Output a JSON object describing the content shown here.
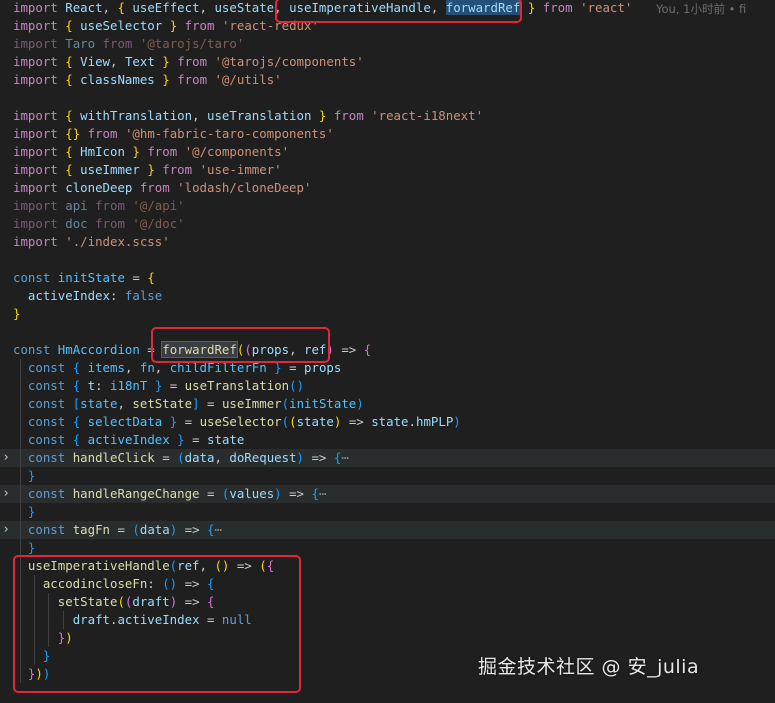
{
  "blame_text": "You, 1小时前 • fi",
  "watermark": "掘金技术社区 @ 安_julia",
  "colors": {
    "background": "#1f1f1f",
    "annotation_box": "#e0283a",
    "keyword": "#5c9fd6",
    "import_keyword": "#c586c0",
    "string": "#ce9178",
    "variable": "#9cdcfe",
    "constant": "#4fc1ff",
    "function": "#dcdcaa"
  },
  "lines": [
    {
      "tokens": [
        [
          "import",
          "imp"
        ],
        [
          " "
        ],
        [
          "React",
          "var"
        ],
        [
          ", "
        ],
        [
          "{",
          "br1"
        ],
        [
          " "
        ],
        [
          "useEffect",
          "var"
        ],
        [
          ", "
        ],
        [
          "useState",
          "var"
        ],
        [
          ", "
        ],
        [
          "useImperativeHandle",
          "var"
        ],
        [
          ", "
        ],
        [
          "forwardRef",
          "var selblue"
        ],
        [
          " "
        ],
        [
          "}",
          "br1"
        ],
        [
          " "
        ],
        [
          "from",
          "imp"
        ],
        [
          " "
        ],
        [
          "'react'",
          "str"
        ]
      ]
    },
    {
      "tokens": [
        [
          "import",
          "imp"
        ],
        [
          " "
        ],
        [
          "{",
          "br1"
        ],
        [
          " "
        ],
        [
          "useSelector",
          "var"
        ],
        [
          " "
        ],
        [
          "}",
          "br1"
        ],
        [
          " "
        ],
        [
          "from",
          "imp"
        ],
        [
          " "
        ],
        [
          "'react-redux'",
          "str"
        ]
      ]
    },
    {
      "tokens": [
        [
          "import",
          "imp dim"
        ],
        [
          " "
        ],
        [
          "Taro",
          "var dim"
        ],
        [
          " "
        ],
        [
          "from",
          "imp dim"
        ],
        [
          " "
        ],
        [
          "'@tarojs/taro'",
          "str dim"
        ]
      ]
    },
    {
      "tokens": [
        [
          "import",
          "imp"
        ],
        [
          " "
        ],
        [
          "{",
          "br1"
        ],
        [
          " "
        ],
        [
          "View",
          "var"
        ],
        [
          ", "
        ],
        [
          "Text",
          "var"
        ],
        [
          " "
        ],
        [
          "}",
          "br1"
        ],
        [
          " "
        ],
        [
          "from",
          "imp"
        ],
        [
          " "
        ],
        [
          "'@tarojs/components'",
          "str"
        ]
      ]
    },
    {
      "tokens": [
        [
          "import",
          "imp"
        ],
        [
          " "
        ],
        [
          "{",
          "br1"
        ],
        [
          " "
        ],
        [
          "classNames",
          "var"
        ],
        [
          " "
        ],
        [
          "}",
          "br1"
        ],
        [
          " "
        ],
        [
          "from",
          "imp"
        ],
        [
          " "
        ],
        [
          "'@/utils'",
          "str"
        ]
      ]
    },
    {
      "tokens": []
    },
    {
      "tokens": [
        [
          "import",
          "imp"
        ],
        [
          " "
        ],
        [
          "{",
          "br1"
        ],
        [
          " "
        ],
        [
          "withTranslation",
          "var"
        ],
        [
          ", "
        ],
        [
          "useTranslation",
          "var"
        ],
        [
          " "
        ],
        [
          "}",
          "br1"
        ],
        [
          " "
        ],
        [
          "from",
          "imp"
        ],
        [
          " "
        ],
        [
          "'react-i18next'",
          "str"
        ]
      ]
    },
    {
      "tokens": [
        [
          "import",
          "imp"
        ],
        [
          " "
        ],
        [
          "{}",
          "br1"
        ],
        [
          " "
        ],
        [
          "from",
          "imp"
        ],
        [
          " "
        ],
        [
          "'@hm-fabric-taro-components'",
          "str"
        ]
      ]
    },
    {
      "tokens": [
        [
          "import",
          "imp"
        ],
        [
          " "
        ],
        [
          "{",
          "br1"
        ],
        [
          " "
        ],
        [
          "HmIcon",
          "var"
        ],
        [
          " "
        ],
        [
          "}",
          "br1"
        ],
        [
          " "
        ],
        [
          "from",
          "imp"
        ],
        [
          " "
        ],
        [
          "'@/components'",
          "str"
        ]
      ]
    },
    {
      "tokens": [
        [
          "import",
          "imp"
        ],
        [
          " "
        ],
        [
          "{",
          "br1"
        ],
        [
          " "
        ],
        [
          "useImmer",
          "var"
        ],
        [
          " "
        ],
        [
          "}",
          "br1"
        ],
        [
          " "
        ],
        [
          "from",
          "imp"
        ],
        [
          " "
        ],
        [
          "'use-immer'",
          "str"
        ]
      ]
    },
    {
      "tokens": [
        [
          "import",
          "imp"
        ],
        [
          " "
        ],
        [
          "cloneDeep",
          "var"
        ],
        [
          " "
        ],
        [
          "from",
          "imp"
        ],
        [
          " "
        ],
        [
          "'lodash/cloneDeep'",
          "str"
        ]
      ]
    },
    {
      "tokens": [
        [
          "import",
          "imp dim"
        ],
        [
          " "
        ],
        [
          "api",
          "var dim"
        ],
        [
          " "
        ],
        [
          "from",
          "imp dim"
        ],
        [
          " "
        ],
        [
          "'@/api'",
          "str dim"
        ]
      ]
    },
    {
      "tokens": [
        [
          "import",
          "imp dim"
        ],
        [
          " "
        ],
        [
          "doc",
          "var dim"
        ],
        [
          " "
        ],
        [
          "from",
          "imp dim"
        ],
        [
          " "
        ],
        [
          "'@/doc'",
          "str dim"
        ]
      ]
    },
    {
      "tokens": [
        [
          "import",
          "imp"
        ],
        [
          " "
        ],
        [
          "'./index.scss'",
          "str"
        ]
      ]
    },
    {
      "tokens": []
    },
    {
      "tokens": [
        [
          "const",
          "kw"
        ],
        [
          " "
        ],
        [
          "initState",
          "cst"
        ],
        [
          " = "
        ],
        [
          "{",
          "br1"
        ]
      ]
    },
    {
      "tokens": [
        [
          "  "
        ],
        [
          "activeIndex",
          "var"
        ],
        [
          ": "
        ],
        [
          "false",
          "kw"
        ]
      ]
    },
    {
      "tokens": [
        [
          "}",
          "br1"
        ]
      ]
    },
    {
      "tokens": []
    },
    {
      "tokens": [
        [
          "const",
          "kw"
        ],
        [
          " "
        ],
        [
          "HmAccordion",
          "cst"
        ],
        [
          " = "
        ],
        [
          "forwardRef",
          "fn sel"
        ],
        [
          "(",
          "br1"
        ],
        [
          "(",
          "br2"
        ],
        [
          "props",
          "var"
        ],
        [
          ", "
        ],
        [
          "ref",
          "var"
        ],
        [
          ")",
          "br2"
        ],
        [
          " => "
        ],
        [
          "{",
          "br2"
        ]
      ]
    },
    {
      "tokens": [
        [
          "  "
        ],
        [
          "const",
          "kw"
        ],
        [
          " "
        ],
        [
          "{",
          "br3"
        ],
        [
          " "
        ],
        [
          "items",
          "cst"
        ],
        [
          ", "
        ],
        [
          "fn",
          "cst"
        ],
        [
          ", "
        ],
        [
          "childFilterFn",
          "cst"
        ],
        [
          " "
        ],
        [
          "}",
          "br3"
        ],
        [
          " = "
        ],
        [
          "props",
          "var"
        ]
      ]
    },
    {
      "tokens": [
        [
          "  "
        ],
        [
          "const",
          "kw"
        ],
        [
          " "
        ],
        [
          "{",
          "br3"
        ],
        [
          " "
        ],
        [
          "t",
          "var"
        ],
        [
          ": "
        ],
        [
          "i18nT",
          "cst"
        ],
        [
          " "
        ],
        [
          "}",
          "br3"
        ],
        [
          " = "
        ],
        [
          "useTranslation",
          "fn"
        ],
        [
          "()",
          "br3"
        ]
      ]
    },
    {
      "tokens": [
        [
          "  "
        ],
        [
          "const",
          "kw"
        ],
        [
          " "
        ],
        [
          "[",
          "br3"
        ],
        [
          "state",
          "cst"
        ],
        [
          ", "
        ],
        [
          "setState",
          "fn"
        ],
        [
          "]",
          "br3"
        ],
        [
          " = "
        ],
        [
          "useImmer",
          "fn"
        ],
        [
          "(",
          "br3"
        ],
        [
          "initState",
          "cst"
        ],
        [
          ")",
          "br3"
        ]
      ]
    },
    {
      "tokens": [
        [
          "  "
        ],
        [
          "const",
          "kw"
        ],
        [
          " "
        ],
        [
          "{",
          "br3"
        ],
        [
          " "
        ],
        [
          "selectData",
          "cst"
        ],
        [
          " "
        ],
        [
          "}",
          "br3"
        ],
        [
          " = "
        ],
        [
          "useSelector",
          "fn"
        ],
        [
          "(",
          "br3"
        ],
        [
          "(",
          "br1"
        ],
        [
          "state",
          "var"
        ],
        [
          ")",
          "br1"
        ],
        [
          " => "
        ],
        [
          "state",
          "var"
        ],
        [
          "."
        ],
        [
          "hmPLP",
          "var"
        ],
        [
          ")",
          "br3"
        ]
      ]
    },
    {
      "tokens": [
        [
          "  "
        ],
        [
          "const",
          "kw"
        ],
        [
          " "
        ],
        [
          "{",
          "br3"
        ],
        [
          " "
        ],
        [
          "activeIndex",
          "cst"
        ],
        [
          " "
        ],
        [
          "}",
          "br3"
        ],
        [
          " = "
        ],
        [
          "state",
          "var"
        ]
      ]
    },
    {
      "fold": true,
      "hl": true,
      "tokens": [
        [
          "  "
        ],
        [
          "const",
          "kw"
        ],
        [
          " "
        ],
        [
          "handleClick",
          "fn"
        ],
        [
          " = "
        ],
        [
          "(",
          "br3"
        ],
        [
          "data",
          "var"
        ],
        [
          ", "
        ],
        [
          "doRequest",
          "var"
        ],
        [
          ")",
          "br3"
        ],
        [
          " => "
        ],
        [
          "{",
          "br3"
        ],
        [
          "⋯",
          "fold"
        ]
      ]
    },
    {
      "tokens": [
        [
          "  "
        ],
        [
          "}",
          "br3"
        ]
      ]
    },
    {
      "fold": true,
      "hl": true,
      "tokens": [
        [
          "  "
        ],
        [
          "const",
          "kw"
        ],
        [
          " "
        ],
        [
          "handleRangeChange",
          "fn"
        ],
        [
          " = "
        ],
        [
          "(",
          "br3"
        ],
        [
          "values",
          "var"
        ],
        [
          ")",
          "br3"
        ],
        [
          " => "
        ],
        [
          "{",
          "br3"
        ],
        [
          "⋯",
          "fold"
        ]
      ]
    },
    {
      "tokens": [
        [
          "  "
        ],
        [
          "}",
          "br3"
        ]
      ]
    },
    {
      "fold": true,
      "hl": true,
      "tokens": [
        [
          "  "
        ],
        [
          "const",
          "kw"
        ],
        [
          " "
        ],
        [
          "tagFn",
          "fn"
        ],
        [
          " = "
        ],
        [
          "(",
          "br3"
        ],
        [
          "data",
          "var"
        ],
        [
          ")",
          "br3"
        ],
        [
          " => "
        ],
        [
          "{",
          "br3"
        ],
        [
          "⋯",
          "fold"
        ]
      ]
    },
    {
      "tokens": [
        [
          "  "
        ],
        [
          "}",
          "br3"
        ]
      ]
    },
    {
      "tokens": [
        [
          "  "
        ],
        [
          "useImperativeHandle",
          "fn"
        ],
        [
          "(",
          "br3"
        ],
        [
          "ref",
          "var"
        ],
        [
          ", "
        ],
        [
          "()",
          "br1"
        ],
        [
          " => "
        ],
        [
          "(",
          "br1"
        ],
        [
          "{",
          "br2"
        ]
      ]
    },
    {
      "tokens": [
        [
          "    "
        ],
        [
          "accodincloseFn",
          "fn"
        ],
        [
          ": "
        ],
        [
          "()",
          "br3"
        ],
        [
          " => "
        ],
        [
          "{",
          "br3"
        ]
      ]
    },
    {
      "tokens": [
        [
          "      "
        ],
        [
          "setState",
          "fn"
        ],
        [
          "(",
          "br1"
        ],
        [
          "(",
          "br2"
        ],
        [
          "draft",
          "var"
        ],
        [
          ")",
          "br2"
        ],
        [
          " => "
        ],
        [
          "{",
          "br2"
        ]
      ]
    },
    {
      "tokens": [
        [
          "        "
        ],
        [
          "draft",
          "var"
        ],
        [
          "."
        ],
        [
          "activeIndex",
          "var"
        ],
        [
          " = "
        ],
        [
          "null",
          "kw"
        ]
      ]
    },
    {
      "tokens": [
        [
          "      "
        ],
        [
          "}",
          "br2"
        ],
        [
          ")",
          "br1"
        ]
      ]
    },
    {
      "tokens": [
        [
          "    "
        ],
        [
          "}",
          "br3"
        ]
      ]
    },
    {
      "tokens": [
        [
          "  "
        ],
        [
          "}",
          "br2"
        ],
        [
          ")",
          "br1"
        ],
        [
          ")",
          "br3"
        ]
      ]
    },
    {
      "tokens": []
    }
  ]
}
